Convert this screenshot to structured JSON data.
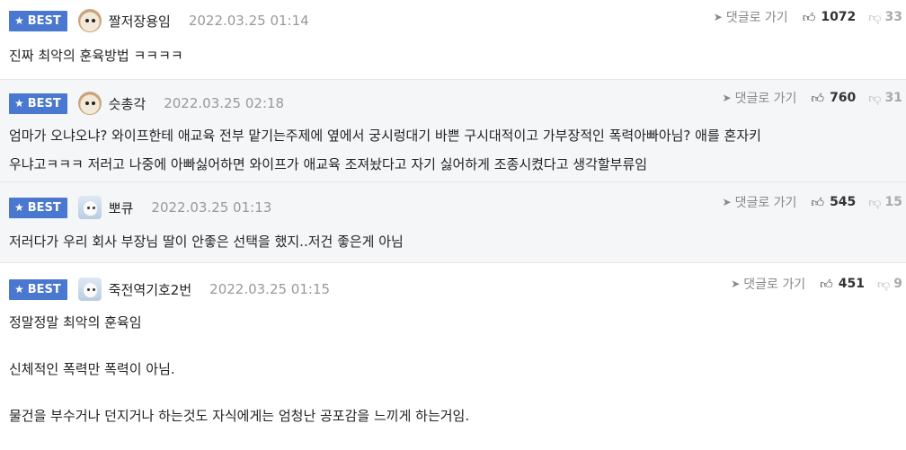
{
  "best_label": "BEST",
  "reply_label": "댓글로 가기",
  "icons": {
    "best_star": "star-icon",
    "reply": "reply-arrow-icon",
    "upvote": "thumbs-up-icon",
    "downvote": "thumbs-down-icon"
  },
  "colors": {
    "best_badge": "#4a77cf",
    "date": "#999999",
    "alt_row_bg": "#f5f6f8"
  },
  "comments": [
    {
      "nick": "짤저장용임",
      "avatar": "dog-avatar",
      "date": "2022.03.25 01:14",
      "up": "1072",
      "down": "33",
      "lines": [
        "진짜 최악의 훈육방법 ㅋㅋㅋㅋ"
      ]
    },
    {
      "nick": "슷총각",
      "avatar": "dog-avatar",
      "date": "2022.03.25 02:18",
      "up": "760",
      "down": "31",
      "lines": [
        "엄마가 오냐오냐? 와이프한테 애교육 전부 맡기는주제에 옆에서 궁시렁대기 바쁜 구시대적이고 가부장적인 폭력아빠아님? 애를 혼자키",
        "우냐고ㅋㅋㅋ 저러고 나중에 아빠싫어하면 와이프가 애교육 조져놨다고 자기 싫어하게 조종시켰다고 생각할부류임"
      ]
    },
    {
      "nick": "뽀큐",
      "avatar": "puppy-avatar",
      "date": "2022.03.25 01:13",
      "up": "545",
      "down": "15",
      "lines": [
        "저러다가 우리 회사 부장님 딸이 안좋은 선택을 했지..저건 좋은게 아님"
      ]
    },
    {
      "nick": "죽전역기호2번",
      "avatar": "puppy-avatar",
      "date": "2022.03.25 01:15",
      "up": "451",
      "down": "9",
      "lines": [
        "정말정말 최악의 훈육임",
        "신체적인 폭력만 폭력이 아님.",
        "물건을 부수거나 던지거나 하는것도 자식에게는 엄청난 공포감을 느끼게 하는거임."
      ]
    }
  ]
}
